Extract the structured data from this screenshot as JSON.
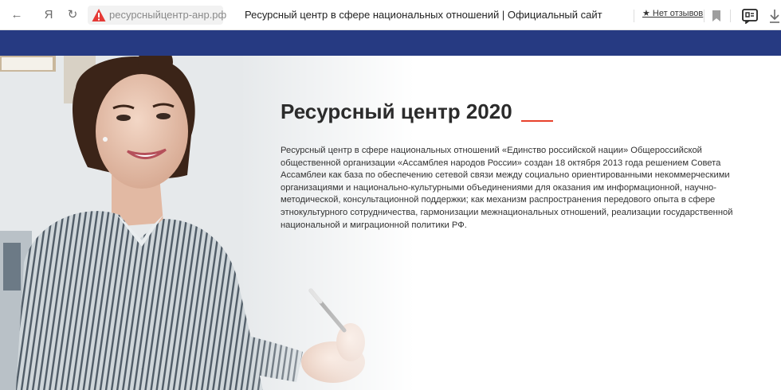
{
  "browser": {
    "back_glyph": "←",
    "logo_glyph": "Я",
    "reload_glyph": "↻",
    "url": "ресурсныйцентр-анр.рф",
    "tab_title": "Ресурсный центр в сфере национальных отношений | Официальный сайт",
    "review_label": "★ Нет отзывов",
    "icons": [
      "back-icon",
      "yandex-logo-icon",
      "reload-icon",
      "warning-icon",
      "bookmark-icon",
      "extension-icon",
      "download-icon"
    ],
    "colors": {
      "warning": "#e53935",
      "header_band": "#263a82",
      "accent": "#e8412c"
    }
  },
  "hero": {
    "title": "Ресурсный центр 2020",
    "text": "Ресурсный центр в сфере национальных отношений «Единство российской нации» Общероссийской общественной организации «Ассамблея народов России» создан 18 октября 2013 года решением Совета Ассамблеи как база по обеспечению сетевой связи между социально ориентированными некоммерческими организациями и национально-культурными объединениями для оказания им информационной, научно-методической, консультационной поддержки; как механизм распространения передового опыта в сфере этнокультурного сотрудничества, гармонизации межнациональных отношений, реализации государственной национальной и миграционной политики РФ."
  }
}
